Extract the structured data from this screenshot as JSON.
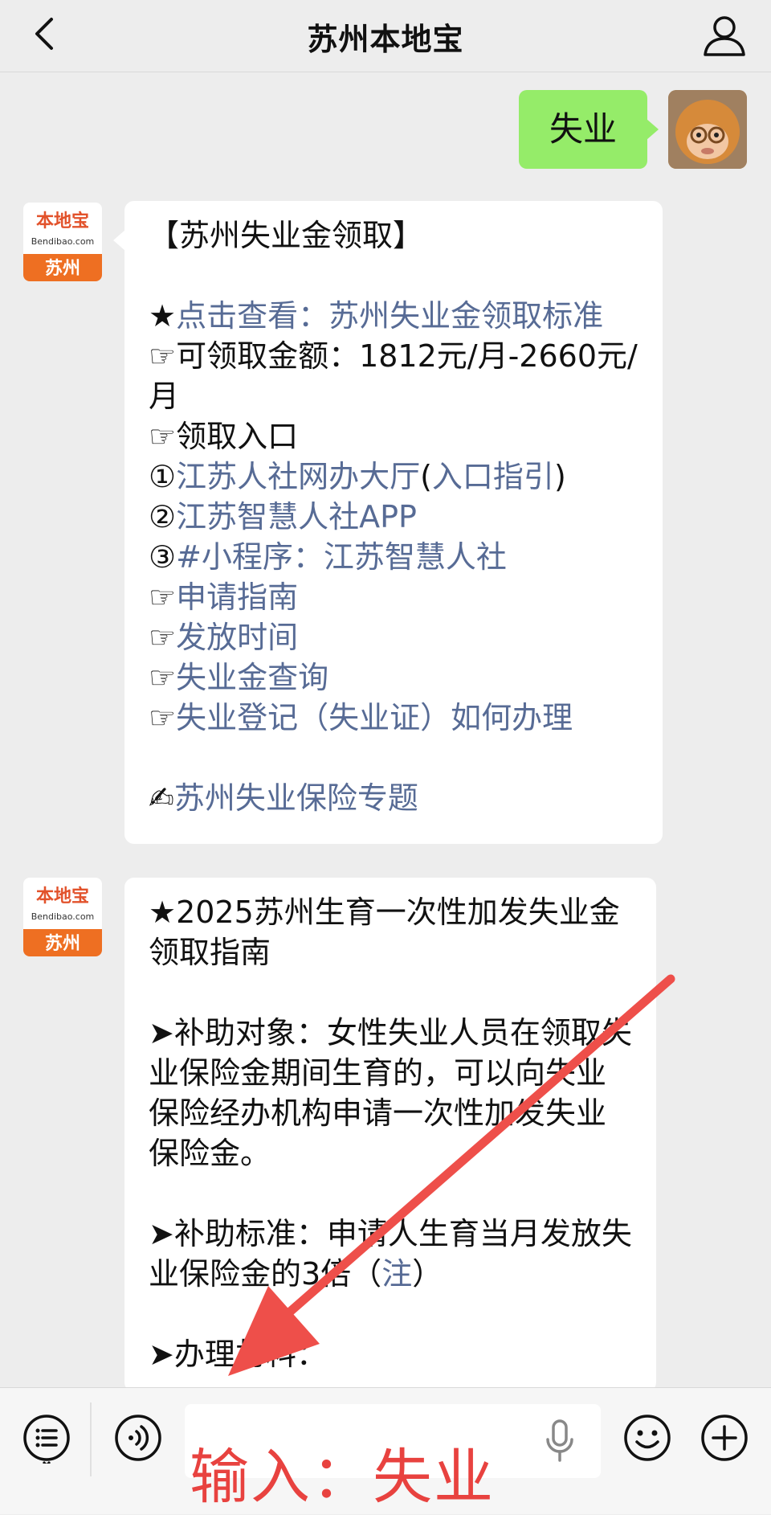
{
  "navbar": {
    "title": "苏州本地宝",
    "back_icon": "chevron-left-icon",
    "profile_icon": "person-icon"
  },
  "messages": {
    "user_text": "失业",
    "bot_logo": {
      "brand": "本地宝",
      "domain": "Bendibao.com",
      "city": "苏州"
    },
    "card1": {
      "title": "【苏州失业金领取】",
      "star_prefix": "★",
      "star_link": "点击查看：苏州失业金领取标准",
      "hand": "☞",
      "amount_label": "可领取金额：1812元/月-2660元/月",
      "entry_label": "领取入口",
      "entry1_num": "①",
      "entry1_link": "江苏人社网办大厅",
      "entry1_paren_open": "(",
      "entry1_guide": "入口指引",
      "entry1_paren_close": ")",
      "entry2_num": "②",
      "entry2_link": "江苏智慧人社APP",
      "entry3_num": "③",
      "entry3_link": "#小程序：江苏智慧人社",
      "link_apply": "申请指南",
      "link_time": "发放时间",
      "link_query": "失业金查询",
      "link_register": "失业登记（失业证）如何办理",
      "write_emoji": "✍",
      "topic_link": "苏州失业保险专题"
    },
    "card2": {
      "title": "★2025苏州生育一次性加发失业金领取指南",
      "target_label": "➤补助对象：女性失业人员在领取失业保险金期间生育的，可以向失业保险经办机构申请一次性加发失业保险金。",
      "standard_prefix": "➤补助标准：申请人生育当月发放失业保险金的3倍（",
      "standard_note": "注",
      "standard_suffix": "）",
      "materials_label": "➤办理材料："
    }
  },
  "bottombar": {
    "menu_icon": "list-menu-icon",
    "voice_icon": "voice-icon",
    "mic_icon": "microphone-icon",
    "emoji_icon": "emoji-smile-icon",
    "plus_icon": "plus-circle-icon"
  },
  "annotation": {
    "text": "输入：失业",
    "color": "#e8423f"
  },
  "colors": {
    "link": "#576b95",
    "user_bubble": "#95ec69",
    "background": "#ededed"
  }
}
